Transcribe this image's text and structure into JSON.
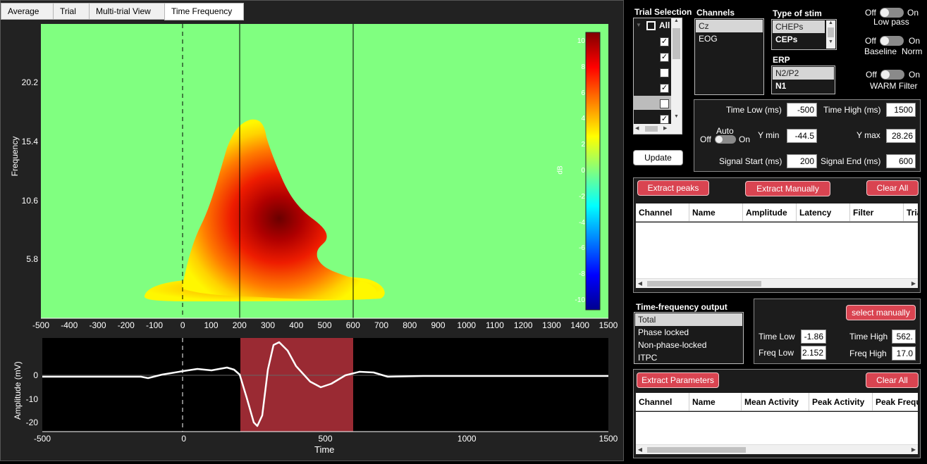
{
  "tabs": [
    {
      "label": "Average"
    },
    {
      "label": "Trial"
    },
    {
      "label": "Multi-trial View"
    },
    {
      "label": "Time Frequency"
    }
  ],
  "tf_plot": {
    "ylabel": "Frequency",
    "y_ticks": [
      "20.2",
      "15.4",
      "10.6",
      "5.8"
    ],
    "x_ticks": [
      "-500",
      "-400",
      "-300",
      "-200",
      "-100",
      "0",
      "100",
      "200",
      "300",
      "400",
      "500",
      "600",
      "700",
      "800",
      "900",
      "1000",
      "1100",
      "1200",
      "1300",
      "1400",
      "1500"
    ],
    "colorbar_label": "dB",
    "colorbar_ticks": [
      "10",
      "8",
      "6",
      "4",
      "2",
      "0",
      "-2",
      "-4",
      "-6",
      "-8",
      "-10"
    ],
    "colormap": "jet",
    "background_color": "#80ff80",
    "marker_lines_ms": [
      0,
      200,
      600
    ]
  },
  "erp_plot": {
    "ylabel": "Amplitude (mV)",
    "xlabel": "Time",
    "y_ticks": [
      "0",
      "-10",
      "-20"
    ],
    "x_ticks": [
      "-500",
      "0",
      "500",
      "1000",
      "1500"
    ],
    "highlight_window_ms": [
      200,
      600
    ],
    "highlight_color": "#9a2a33"
  },
  "trial_selection": {
    "title": "Trial Selection",
    "all_label": "All",
    "rows": [
      {
        "checked": true
      },
      {
        "checked": true
      },
      {
        "checked": false
      },
      {
        "checked": true
      },
      {
        "checked": false
      },
      {
        "checked": true
      }
    ]
  },
  "channels": {
    "title": "Channels",
    "items": [
      "Cz",
      "EOG"
    ],
    "selected": "Cz"
  },
  "type_of_stim": {
    "title": "Type of stim",
    "items": [
      "CHEPs",
      "CEPs"
    ],
    "selected": "CHEPs"
  },
  "erp": {
    "title": "ERP",
    "items": [
      "N2/P2",
      "N1"
    ],
    "selected": "N2/P2"
  },
  "toggles": {
    "off": "Off",
    "on": "On",
    "low_pass": "Low pass",
    "baseline": "Baseline",
    "norm": "Norm",
    "warm_filter": "WARM Filter"
  },
  "settings": {
    "time_low_label": "Time Low (ms)",
    "time_low": "-500",
    "time_high_label": "Time High (ms)",
    "time_high": "1500",
    "auto_label": "Auto",
    "auto_off": "Off",
    "auto_on": "On",
    "ymin_label": "Y min",
    "ymin": "-44.5",
    "ymax_label": "Y max",
    "ymax": "28.26",
    "signal_start_label": "Signal Start (ms)",
    "signal_start": "200",
    "signal_end_label": "Signal End (ms)",
    "signal_end": "600"
  },
  "update_button": "Update",
  "peaks": {
    "extract_peaks": "Extract peaks",
    "extract_manually": "Extract Manually",
    "clear_all": "Clear All",
    "columns": [
      "Channel",
      "Name",
      "Amplitude",
      "Latency",
      "Filter",
      "Trial"
    ]
  },
  "tf_output": {
    "title": "Time-frequency output",
    "items": [
      "Total",
      "Phase locked",
      "Non-phase-locked",
      "ITPC"
    ],
    "selected": "Total"
  },
  "tf_window": {
    "select_manually": "select manually",
    "time_low_label": "Time Low",
    "time_low": "-1.86",
    "time_high_label": "Time High",
    "time_high": "562.",
    "freq_low_label": "Freq Low",
    "freq_low": "2.152",
    "freq_high_label": "Freq High",
    "freq_high": "17.0"
  },
  "parameters": {
    "extract_parameters": "Extract Parameters",
    "clear_all": "Clear All",
    "columns": [
      "Channel",
      "Name",
      "Mean Activity",
      "Peak Activity",
      "Peak Frequency"
    ]
  }
}
